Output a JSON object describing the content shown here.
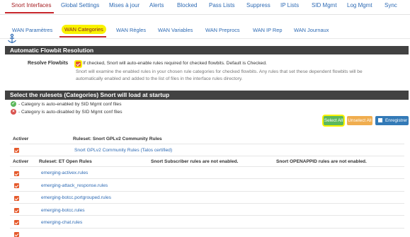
{
  "top_tabs": [
    {
      "label": "Snort Interfaces",
      "active": true
    },
    {
      "label": "Global Settings"
    },
    {
      "label": "Mises à jour"
    },
    {
      "label": "Alerts"
    },
    {
      "label": "Blocked"
    },
    {
      "label": "Pass Lists"
    },
    {
      "label": "Suppress"
    },
    {
      "label": "IP Lists"
    },
    {
      "label": "SID Mgmt"
    },
    {
      "label": "Log Mgmt"
    },
    {
      "label": "Sync"
    }
  ],
  "sub_tabs": [
    {
      "label": "WAN Paramètres"
    },
    {
      "label": "WAN Categories",
      "active": true
    },
    {
      "label": "WAN Règles"
    },
    {
      "label": "WAN Variables"
    },
    {
      "label": "WAN Preprocs"
    },
    {
      "label": "WAN IP Rep"
    },
    {
      "label": "WAN Journaux"
    }
  ],
  "flowbit_panel": {
    "title": "Automatic Flowbit Resolution",
    "resolve_label": "Resolve Flowbits",
    "checkbox_text": "If checked, Snort will auto-enable rules required for checked flowbits. Default is Checked.",
    "help_text": "Snort will examine the enabled rules in your chosen rule categories for checked flowbits. Any rules that set these dependent flowbits will be automatically enabled and added to the list of files in the interface rules directory.",
    "checked": true
  },
  "rulesets_panel": {
    "title": "Select the rulesets (Categories) Snort will load at startup",
    "legend_enabled": "- Category is auto-enabled by SID Mgmt conf files",
    "legend_disabled": "- Category is auto-disabled by SID Mgmt conf files",
    "btn_select_all": "Select All",
    "btn_unselect_all": "Unselect All",
    "btn_save": "Enregistrer",
    "colors": {
      "select": "#5cb85c",
      "unselect": "#f0ad4e",
      "save": "#337ab7",
      "highlight": "#f9f300"
    }
  },
  "gplv2": {
    "col_activer": "Activer",
    "col_ruleset": "Ruleset: Snort GPLv2 Community Rules",
    "row": "Snort GPLv2 Community Rules (Talos certified)"
  },
  "et_table": {
    "col_activer": "Activer",
    "col_ruleset": "Ruleset: ET Open Rules",
    "col_subscriber": "Snort Subscriber rules are not enabled.",
    "col_openappid": "Snort OPENAPPID rules are not enabled.",
    "rows": [
      "emerging-activex.rules",
      "emerging-attack_response.rules",
      "emerging-botcc.portgrouped.rules",
      "emerging-botcc.rules",
      "emerging-chat.rules"
    ]
  }
}
